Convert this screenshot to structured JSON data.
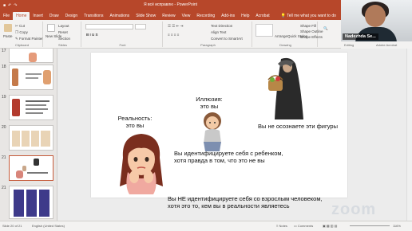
{
  "window": {
    "title": "Я всё исправлю - PowerPoint",
    "qa_icons": [
      "save-icon",
      "undo-icon",
      "redo-icon"
    ]
  },
  "tabs": [
    "File",
    "Home",
    "Insert",
    "Draw",
    "Design",
    "Transitions",
    "Animations",
    "Slide Show",
    "Review",
    "View",
    "Recording",
    "Add-ins",
    "Help",
    "Acrobat"
  ],
  "active_tab": "Home",
  "tell_me": "Tell me what you want to do",
  "ribbon": {
    "clipboard": {
      "label": "Clipboard",
      "paste": "Paste",
      "cut": "Cut",
      "copy": "Copy",
      "format_painter": "Format Painter"
    },
    "slides": {
      "label": "Slides",
      "new_slide": "New Slide",
      "layout": "Layout",
      "reset": "Reset",
      "section": "Section"
    },
    "font": {
      "label": "Font"
    },
    "paragraph": {
      "label": "Paragraph",
      "text_direction": "Text Direction",
      "align_text": "Align Text",
      "convert_smartart": "Convert to SmartArt"
    },
    "drawing": {
      "label": "Drawing",
      "arrange": "Arrange",
      "quick_styles": "Quick Styles",
      "shape_fill": "Shape Fill",
      "shape_outline": "Shape Outline",
      "shape_effects": "Shape Effects"
    },
    "editing": {
      "label": "Editing"
    },
    "adobe": {
      "label": "Adobe Acrobat"
    }
  },
  "video": {
    "name": "Nadezhda Se..."
  },
  "thumbnails": [
    {
      "num": "17"
    },
    {
      "num": "18"
    },
    {
      "num": "19"
    },
    {
      "num": "20"
    },
    {
      "num": "21"
    }
  ],
  "slide": {
    "reality": "Реальность:\nэто вы",
    "illusion": "Иллюзия:\nэто вы",
    "not_aware": "Вы не осознаете эти фигуры",
    "identify_child": "Вы идентифицируете себя с ребенком,\nхотя правда в том, что это не вы",
    "identify_adult": "Вы НЕ идентифицируете себя со взрослым человеком,\nхотя это то, кем вы в реальности являетесь"
  },
  "status": {
    "slide_of": "Slide 20 of 21",
    "language": "English (United States)",
    "notes": "Notes",
    "comments": "Comments",
    "zoom": "116%"
  },
  "overlay": {
    "zoom_logo": "zoom"
  },
  "colors": {
    "accent": "#b7472a",
    "ribbon_bg": "#f3f2f1"
  }
}
